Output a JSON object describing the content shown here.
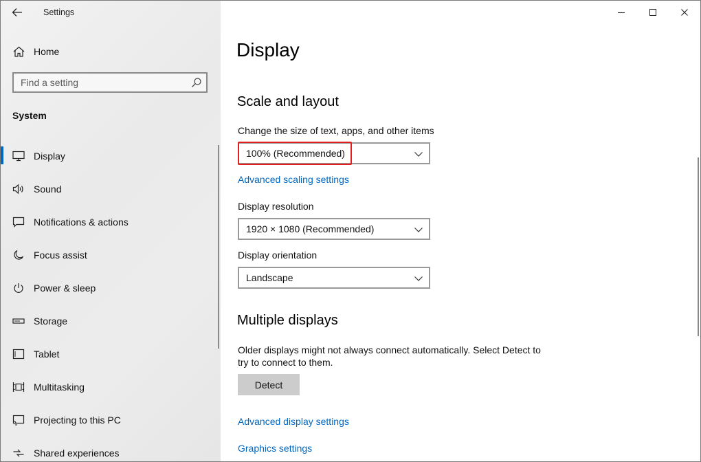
{
  "app": {
    "title": "Settings"
  },
  "sidebar": {
    "home_label": "Home",
    "search_placeholder": "Find a setting",
    "section_title": "System",
    "items": [
      {
        "label": "Display",
        "icon": "monitor-icon",
        "active": true
      },
      {
        "label": "Sound",
        "icon": "speaker-icon"
      },
      {
        "label": "Notifications & actions",
        "icon": "message-icon"
      },
      {
        "label": "Focus assist",
        "icon": "moon-icon"
      },
      {
        "label": "Power & sleep",
        "icon": "power-icon"
      },
      {
        "label": "Storage",
        "icon": "storage-icon"
      },
      {
        "label": "Tablet",
        "icon": "tablet-icon"
      },
      {
        "label": "Multitasking",
        "icon": "multitasking-icon"
      },
      {
        "label": "Projecting to this PC",
        "icon": "projecting-icon"
      },
      {
        "label": "Shared experiences",
        "icon": "shared-icon"
      }
    ]
  },
  "main": {
    "page_title": "Display",
    "scale_section": {
      "heading": "Scale and layout",
      "scale_label": "Change the size of text, apps, and other items",
      "scale_value": "100% (Recommended)",
      "advanced_scaling_link": "Advanced scaling settings",
      "resolution_label": "Display resolution",
      "resolution_value": "1920 × 1080 (Recommended)",
      "orientation_label": "Display orientation",
      "orientation_value": "Landscape"
    },
    "multiple_section": {
      "heading": "Multiple displays",
      "description": "Older displays might not always connect automatically. Select Detect to try to connect to them.",
      "detect_button": "Detect",
      "advanced_display_link": "Advanced display settings",
      "graphics_link": "Graphics settings"
    }
  },
  "colors": {
    "accent": "#0067c0",
    "highlight": "#e21e1e"
  }
}
